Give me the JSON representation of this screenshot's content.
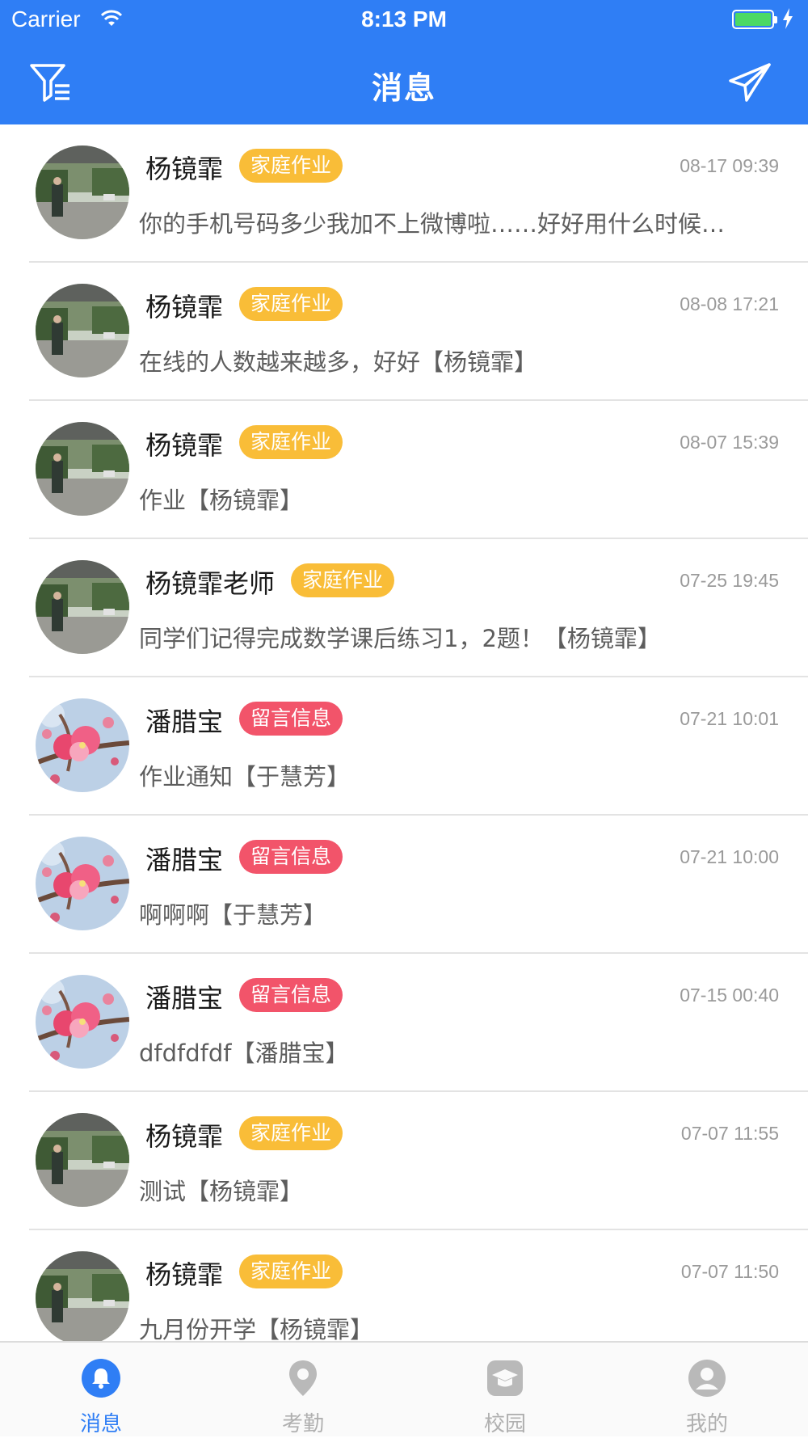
{
  "status_bar": {
    "carrier": "Carrier",
    "time": "8:13 PM",
    "battery_color": "#4cd964"
  },
  "nav": {
    "title": "消息"
  },
  "colors": {
    "brand": "#2f7ef5",
    "tag_homework": "#f9bd38",
    "tag_message": "#f2546a",
    "divider": "#e3e3e3"
  },
  "messages": [
    {
      "name": "杨镜霏",
      "tag": "家庭作业",
      "tag_type": "homework",
      "avatar": "school-photo",
      "time": "08-17 09:39",
      "preview": "你的手机号码多少我加不上微博啦……好好用什么时候…"
    },
    {
      "name": "杨镜霏",
      "tag": "家庭作业",
      "tag_type": "homework",
      "avatar": "school-photo",
      "time": "08-08 17:21",
      "preview": "在线的人数越来越多，好好【杨镜霏】"
    },
    {
      "name": "杨镜霏",
      "tag": "家庭作业",
      "tag_type": "homework",
      "avatar": "school-photo",
      "time": "08-07 15:39",
      "preview": "作业【杨镜霏】"
    },
    {
      "name": "杨镜霏老师",
      "tag": "家庭作业",
      "tag_type": "homework",
      "avatar": "school-photo",
      "time": "07-25 19:45",
      "preview": "同学们记得完成数学课后练习1，2题！【杨镜霏】"
    },
    {
      "name": "潘腊宝",
      "tag": "留言信息",
      "tag_type": "message",
      "avatar": "blossom-photo",
      "time": "07-21 10:01",
      "preview": "作业通知【于慧芳】"
    },
    {
      "name": "潘腊宝",
      "tag": "留言信息",
      "tag_type": "message",
      "avatar": "blossom-photo",
      "time": "07-21 10:00",
      "preview": "啊啊啊【于慧芳】"
    },
    {
      "name": "潘腊宝",
      "tag": "留言信息",
      "tag_type": "message",
      "avatar": "blossom-photo",
      "time": "07-15 00:40",
      "preview": "dfdfdfdf【潘腊宝】"
    },
    {
      "name": "杨镜霏",
      "tag": "家庭作业",
      "tag_type": "homework",
      "avatar": "school-photo",
      "time": "07-07 11:55",
      "preview": "测试【杨镜霏】"
    },
    {
      "name": "杨镜霏",
      "tag": "家庭作业",
      "tag_type": "homework",
      "avatar": "school-photo",
      "time": "07-07 11:50",
      "preview": "九月份开学【杨镜霏】"
    }
  ],
  "tabs": [
    {
      "label": "消息",
      "icon": "bell-icon",
      "active": true
    },
    {
      "label": "考勤",
      "icon": "location-pin-icon",
      "active": false
    },
    {
      "label": "校园",
      "icon": "graduation-cap-icon",
      "active": false
    },
    {
      "label": "我的",
      "icon": "user-icon",
      "active": false
    }
  ]
}
